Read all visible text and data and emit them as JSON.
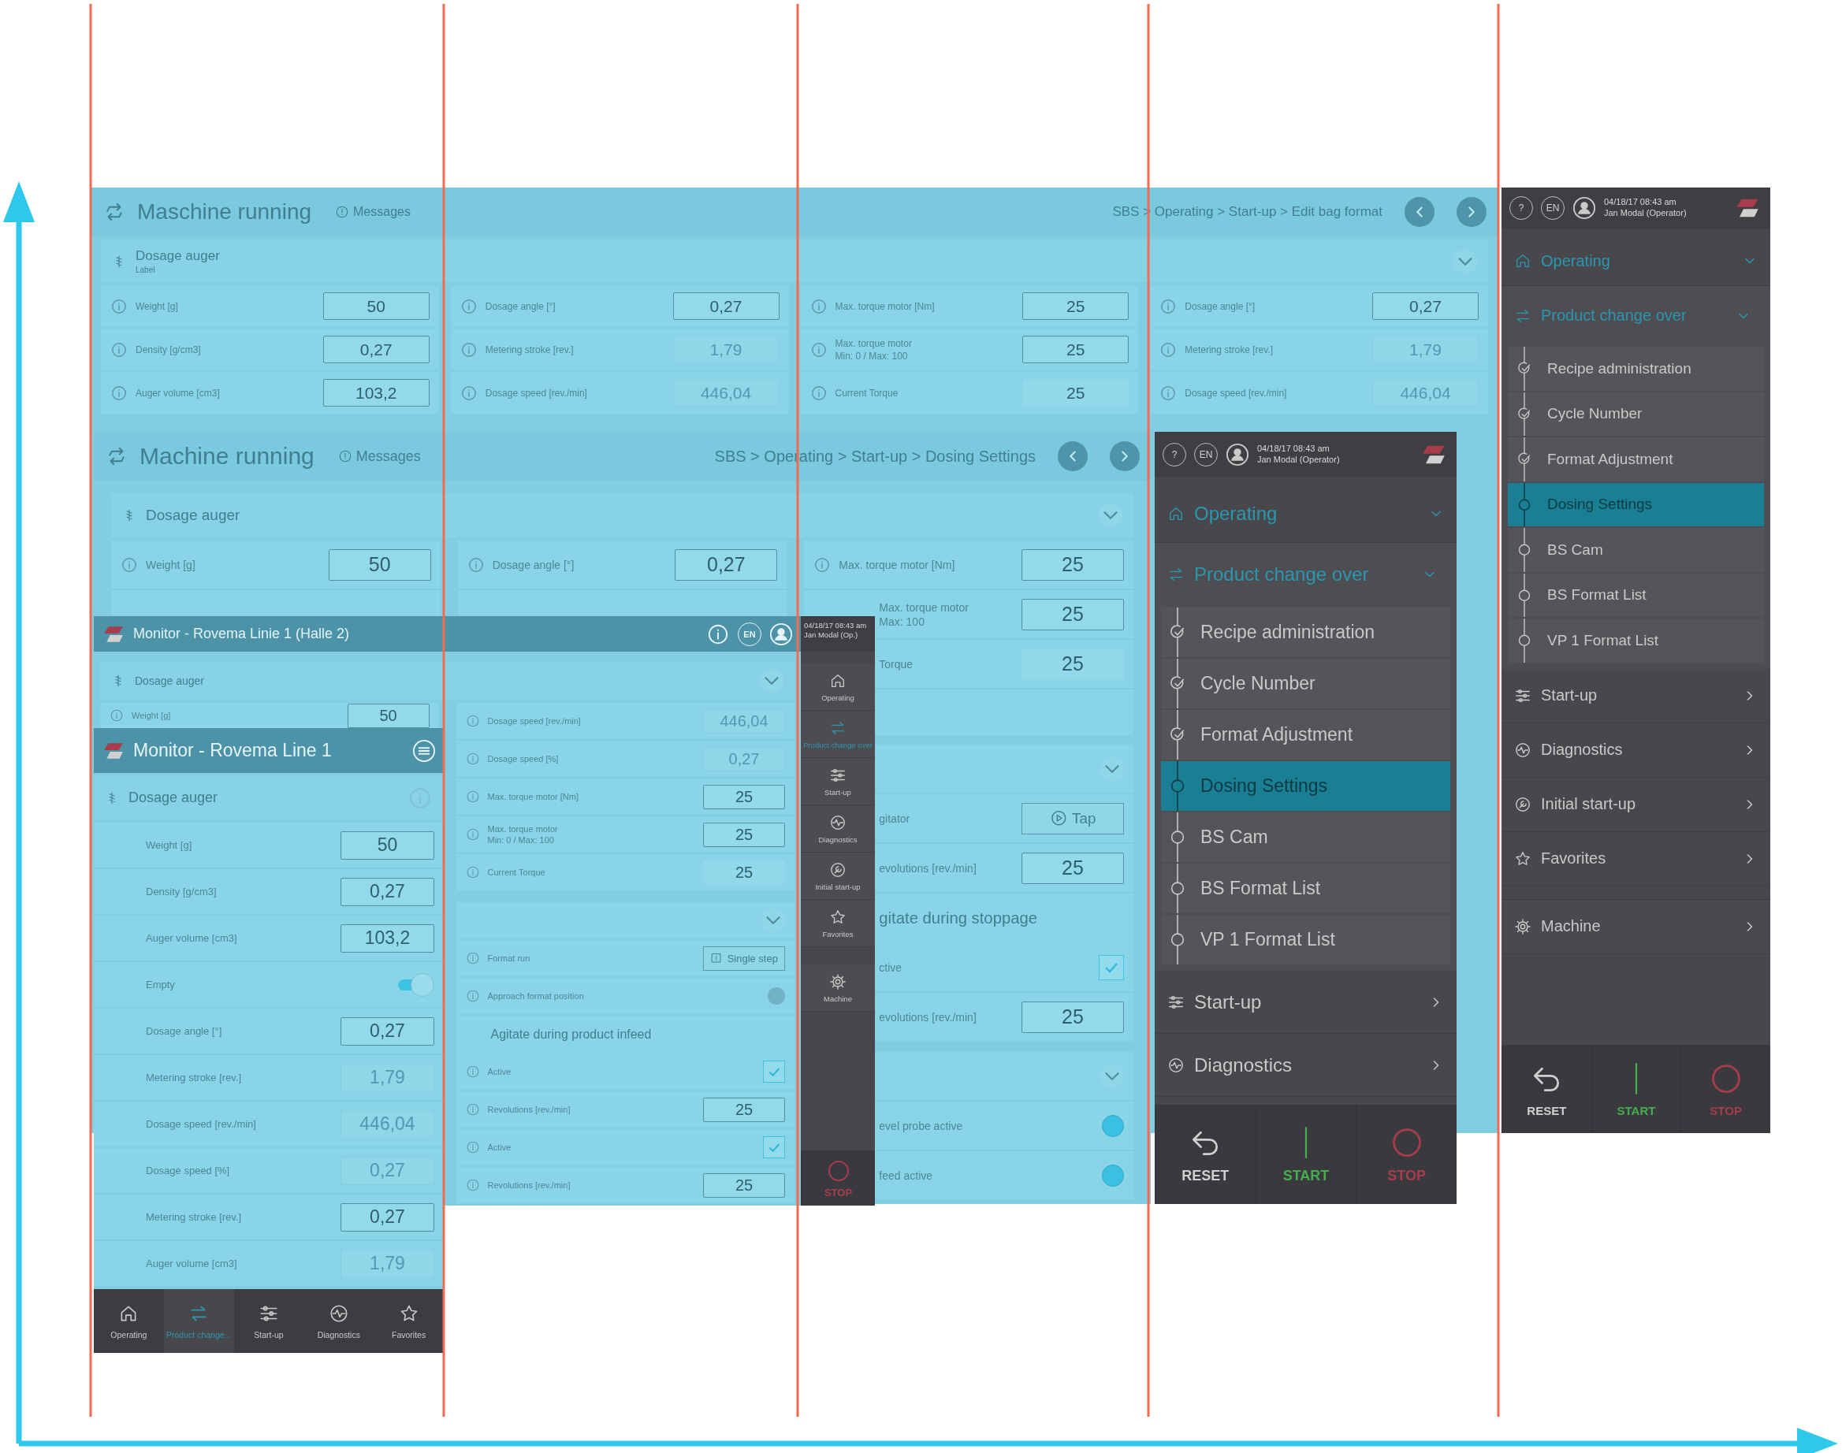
{
  "screens": [
    {
      "kind": "desktop",
      "header": {
        "title": "Maschine running",
        "messages": "Messages",
        "breadcrumb": "SBS > Operating > Start-up > Edit bag format"
      },
      "section": {
        "title": "Dosage auger",
        "subtitle": "Label",
        "expanded": true
      },
      "columns": [
        [
          {
            "rows": [
              {
                "kind": "input",
                "label": "Weight [g]",
                "value": "50",
                "disabled": false,
                "info": true
              },
              {
                "kind": "input",
                "label": "Density [g/cm3]",
                "value": "0,27",
                "disabled": false,
                "info": true
              },
              {
                "kind": "input",
                "label": "Auger volume [cm3]",
                "value": "103,2",
                "disabled": false,
                "info": true
              }
            ]
          }
        ],
        [
          {
            "rows": [
              {
                "kind": "input",
                "label": "Dosage angle [°]",
                "value": "0,27",
                "disabled": false,
                "info": true
              },
              {
                "kind": "input",
                "label": "Metering stroke [rev.]",
                "value": "1,79",
                "disabled": true,
                "info": true
              },
              {
                "kind": "input",
                "label": "Dosage speed [rev./min]",
                "value": "446,04",
                "disabled": true,
                "info": true
              }
            ]
          }
        ],
        [
          {
            "rows": [
              {
                "kind": "input",
                "label": "Max. torque motor [Nm]",
                "value": "25",
                "disabled": false,
                "info": true
              },
              {
                "kind": "input",
                "label": "Max. torque motor",
                "note": "Min: 0 / Max: 100",
                "value": "25",
                "disabled": false,
                "info": true
              },
              {
                "kind": "display",
                "label": "Current Torque",
                "value": "25",
                "info": true
              }
            ]
          }
        ],
        [
          {
            "rows": [
              {
                "kind": "input",
                "label": "Dosage angle [°]",
                "value": "0,27",
                "disabled": false,
                "info": true
              },
              {
                "kind": "input",
                "label": "Metering stroke [rev.]",
                "value": "1,79",
                "disabled": true,
                "info": true
              },
              {
                "kind": "input",
                "label": "Dosage speed [rev./min]",
                "value": "446,04",
                "disabled": true,
                "info": true
              }
            ]
          }
        ]
      ],
      "sidebar": {
        "kind": "nav",
        "help": "?",
        "lang": "EN",
        "date": "04/18/17 08:43 am",
        "user": "Jan Modal (Operator)",
        "items": [
          {
            "label": "Operating",
            "expanded": true,
            "children": [
              {
                "label": "Product change over",
                "expanded": true,
                "children": [
                  {
                    "label": "Recipe administration",
                    "done": true,
                    "selected": false
                  },
                  {
                    "label": "Cycle Number",
                    "done": true,
                    "selected": false
                  },
                  {
                    "label": "Format Adjustment",
                    "done": true,
                    "selected": false
                  },
                  {
                    "label": "Dosing Settings",
                    "done": false,
                    "selected": true
                  },
                  {
                    "label": "BS Cam",
                    "done": false,
                    "selected": false
                  },
                  {
                    "label": "BS Format List",
                    "done": false,
                    "selected": false
                  },
                  {
                    "label": "VP 1 Format List",
                    "done": false,
                    "selected": false
                  }
                ]
              }
            ]
          },
          {
            "label": "Start-up",
            "expanded": false
          },
          {
            "label": "Diagnostics",
            "expanded": false
          },
          {
            "label": "Initial start-up",
            "expanded": false
          },
          {
            "label": "Favorites",
            "expanded": false
          }
        ],
        "footer": [
          {
            "label": "Machine",
            "expanded": false
          }
        ],
        "actions": [
          {
            "kind": "reset",
            "label": "RESET"
          },
          {
            "kind": "start",
            "label": "START"
          },
          {
            "kind": "stop",
            "label": "STOP"
          }
        ]
      }
    },
    {
      "kind": "desktop",
      "header": {
        "title": "Machine running",
        "messages": "Messages",
        "breadcrumb": "SBS > Operating > Start-up > Dosing Settings"
      },
      "section": {
        "title": "Dosage auger",
        "expanded": true
      },
      "columns": [
        [
          {
            "rows": [
              {
                "kind": "input",
                "label": "Weight [g]",
                "value": "50",
                "disabled": false,
                "info": true
              }
            ]
          }
        ],
        [
          {
            "rows": [
              {
                "kind": "input",
                "label": "Dosage angle [°]",
                "value": "0,27",
                "disabled": false,
                "info": true
              }
            ]
          }
        ],
        [
          {
            "rows": [
              {
                "kind": "input",
                "label": "Max. torque motor [Nm]",
                "value": "25",
                "disabled": false,
                "info": true
              },
              {
                "kind": "input",
                "label": "Max. torque motor",
                "note": "Max: 100",
                "value": "25",
                "disabled": false,
                "info": false
              },
              {
                "kind": "display",
                "label": "Torque",
                "value": "25",
                "info": false
              }
            ]
          },
          {
            "expanded": true,
            "rows": [
              {
                "kind": "run-button",
                "label": "gitator",
                "value": "Tap",
                "info": false
              },
              {
                "kind": "input",
                "label": "evolutions [rev./min]",
                "value": "25",
                "disabled": false,
                "info": false
              },
              {
                "kind": "heading",
                "label": "gitate during stoppage"
              },
              {
                "kind": "check",
                "label": "ctive",
                "checked": true,
                "info": false
              },
              {
                "kind": "input",
                "label": "evolutions [rev./min]",
                "value": "25",
                "disabled": false,
                "info": false
              }
            ]
          },
          {
            "expanded": true,
            "rows": [
              {
                "kind": "lamp",
                "label": "evel probe active",
                "on": true,
                "info": false
              },
              {
                "kind": "lamp",
                "label": "feed active",
                "on": true,
                "info": false
              }
            ]
          }
        ]
      ],
      "sidebar": {
        "kind": "nav",
        "help": "?",
        "lang": "EN",
        "date": "04/18/17 08:43 am",
        "user": "Jan Modal (Operator)",
        "items": [
          {
            "label": "Operating",
            "expanded": true,
            "children": [
              {
                "label": "Product change over",
                "expanded": true,
                "children": [
                  {
                    "label": "Recipe administration",
                    "done": true,
                    "selected": false
                  },
                  {
                    "label": "Cycle Number",
                    "done": true,
                    "selected": false
                  },
                  {
                    "label": "Format Adjustment",
                    "done": true,
                    "selected": false
                  },
                  {
                    "label": "Dosing Settings",
                    "done": false,
                    "selected": true
                  },
                  {
                    "label": "BS Cam",
                    "done": false,
                    "selected": false
                  },
                  {
                    "label": "BS Format List",
                    "done": false,
                    "selected": false
                  },
                  {
                    "label": "VP 1 Format List",
                    "done": false,
                    "selected": false
                  }
                ]
              }
            ]
          },
          {
            "label": "Start-up",
            "expanded": false
          },
          {
            "label": "Diagnostics",
            "expanded": false
          }
        ],
        "actions": [
          {
            "kind": "reset",
            "label": "RESET"
          },
          {
            "kind": "start",
            "label": "START"
          },
          {
            "kind": "stop",
            "label": "STOP"
          }
        ]
      }
    },
    {
      "kind": "monitor",
      "header": {
        "title": "Monitor - Rovema Linie 1 (Halle 2)",
        "lang": "EN"
      },
      "section": {
        "title": "Dosage auger",
        "expanded": true
      },
      "columns": [
        [
          {
            "rows": [
              {
                "kind": "input",
                "label": "Weight [g]",
                "value": "50",
                "disabled": false,
                "info": true
              }
            ]
          }
        ],
        [
          {
            "rows": [
              {
                "kind": "input",
                "label": "Dosage speed [rev./min]",
                "value": "446,04",
                "disabled": true,
                "info": true
              },
              {
                "kind": "input",
                "label": "Dosage speed [%]",
                "value": "0,27",
                "disabled": true,
                "info": true
              },
              {
                "kind": "input",
                "label": "Max. torque motor [Nm]",
                "value": "25",
                "disabled": false,
                "info": true
              },
              {
                "kind": "input",
                "label": "Max. torque motor",
                "note": "Min: 0 / Max: 100",
                "value": "25",
                "disabled": false,
                "info": true
              },
              {
                "kind": "display",
                "label": "Current Torque",
                "value": "25",
                "info": true
              }
            ]
          },
          {
            "expanded": true,
            "rows": [
              {
                "kind": "step-button",
                "label": "Format run",
                "value": "Single step",
                "info": true
              },
              {
                "kind": "lamp",
                "label": "Approach format position",
                "on": false,
                "info": true
              },
              {
                "kind": "heading",
                "label": "Agitate during product infeed"
              },
              {
                "kind": "check",
                "label": "Active",
                "checked": true,
                "info": true
              },
              {
                "kind": "input",
                "label": "Revolutions [rev./min]",
                "value": "25",
                "disabled": false,
                "info": true
              },
              {
                "kind": "check",
                "label": "Active",
                "checked": true,
                "info": true
              },
              {
                "kind": "input",
                "label": "Revolutions [rev./min]",
                "value": "25",
                "disabled": false,
                "info": true
              }
            ]
          }
        ]
      ],
      "sidebar": {
        "kind": "rail",
        "date": "04/18/17 08:43 am",
        "user": "Jan Modal (Op.)",
        "items": [
          {
            "label": "Operating",
            "selected": false
          },
          {
            "label": "Product change over",
            "selected": true
          },
          {
            "label": "Start-up",
            "selected": false
          },
          {
            "label": "Diagnostics",
            "selected": false
          },
          {
            "label": "Initial start-up",
            "selected": false
          },
          {
            "label": "Favorites",
            "selected": false
          },
          {
            "label": "Machine",
            "selected": false
          }
        ],
        "actions": [
          {
            "kind": "stop",
            "label": "STOP"
          }
        ]
      }
    },
    {
      "kind": "monitor",
      "header": {
        "title": "Monitor - Rovema Line 1",
        "menu": true
      },
      "section": {
        "title": "Dosage auger",
        "info": true
      },
      "columns": [
        [
          {
            "rows": [
              {
                "kind": "input",
                "label": "Weight [g]",
                "value": "50",
                "disabled": false,
                "info": false
              },
              {
                "kind": "input",
                "label": "Density [g/cm3]",
                "value": "0,27",
                "disabled": false,
                "info": false
              },
              {
                "kind": "input",
                "label": "Auger volume [cm3]",
                "value": "103,2",
                "disabled": false,
                "info": false
              },
              {
                "kind": "toggle",
                "label": "Empty",
                "on": true,
                "info": false
              },
              {
                "kind": "input",
                "label": "Dosage angle [°]",
                "value": "0,27",
                "disabled": false,
                "info": false
              },
              {
                "kind": "input",
                "label": "Metering stroke [rev.]",
                "value": "1,79",
                "disabled": true,
                "info": false
              },
              {
                "kind": "input",
                "label": "Dosage speed [rev./min]",
                "value": "446,04",
                "disabled": true,
                "info": false
              },
              {
                "kind": "input",
                "label": "Dosage speed [%]",
                "value": "0,27",
                "disabled": true,
                "info": false
              },
              {
                "kind": "input",
                "label": "Metering stroke [rev.]",
                "value": "0,27",
                "disabled": false,
                "info": false
              },
              {
                "kind": "input",
                "label": "Auger volume [cm3]",
                "value": "1,79",
                "disabled": true,
                "info": false
              }
            ]
          }
        ]
      ],
      "tabs": [
        {
          "label": "Operating",
          "selected": false
        },
        {
          "label": "Product change...",
          "selected": true
        },
        {
          "label": "Start-up",
          "selected": false
        },
        {
          "label": "Diagnostics",
          "selected": false
        },
        {
          "label": "Favorites",
          "selected": false
        }
      ]
    }
  ]
}
